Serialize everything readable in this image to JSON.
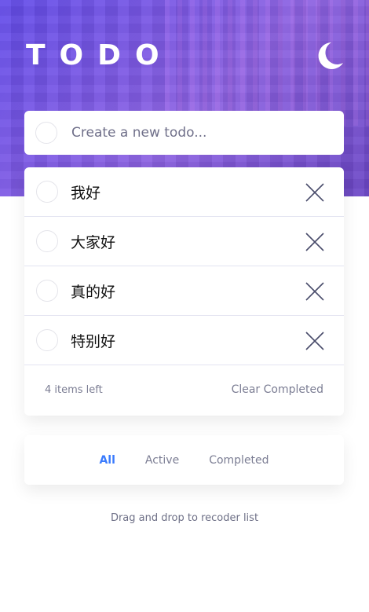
{
  "app": {
    "title": "TODO",
    "theme_icon": "moon-icon",
    "accent_color": "#3a7bfd"
  },
  "new_todo": {
    "placeholder": "Create a new todo...",
    "value": ""
  },
  "todos": [
    {
      "text": "我好",
      "completed": false
    },
    {
      "text": "大家好",
      "completed": false
    },
    {
      "text": "真的好",
      "completed": false
    },
    {
      "text": "特别好",
      "completed": false
    }
  ],
  "footer": {
    "items_left": "4 items left",
    "clear_label": "Clear Completed"
  },
  "filters": [
    {
      "label": "All",
      "active": true
    },
    {
      "label": "Active",
      "active": false
    },
    {
      "label": "Completed",
      "active": false
    }
  ],
  "hint": "Drag and drop to recoder list"
}
